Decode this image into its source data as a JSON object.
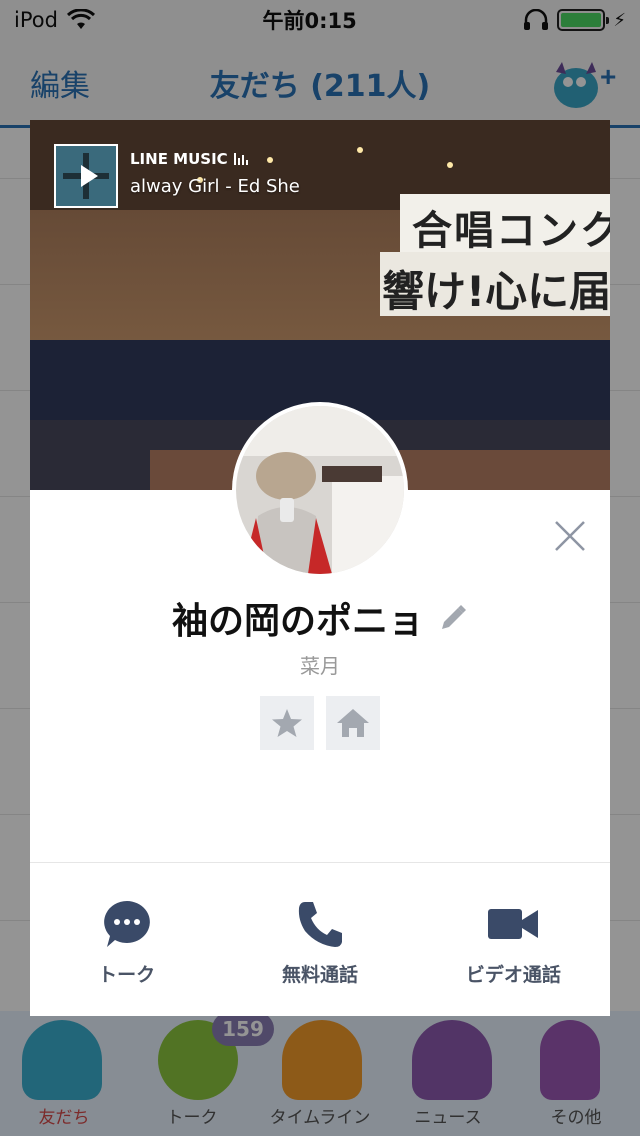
{
  "status_bar": {
    "device": "iPod",
    "time": "午前0:15"
  },
  "nav": {
    "edit": "編集",
    "title": "友だち (211人)"
  },
  "tabs": [
    {
      "label": "友だち"
    },
    {
      "label": "トーク"
    },
    {
      "label": "タイムライン"
    },
    {
      "label": "ニュース"
    },
    {
      "label": "その他"
    }
  ],
  "talk_badge": "159",
  "profile": {
    "name": "袖の岡のポニョ",
    "status_message": "菜月",
    "music": {
      "service": "LINE MUSIC",
      "song": "alway Girl - Ed She"
    },
    "cover_banner": "合唱コンク",
    "cover_banner_sub": "響け!心に届"
  },
  "actions": {
    "talk": "トーク",
    "free_call": "無料通話",
    "video_call": "ビデオ通話"
  },
  "colors": {
    "accent": "#2a72b5",
    "action_icon": "#3a4a68",
    "battery": "#4cd964"
  }
}
